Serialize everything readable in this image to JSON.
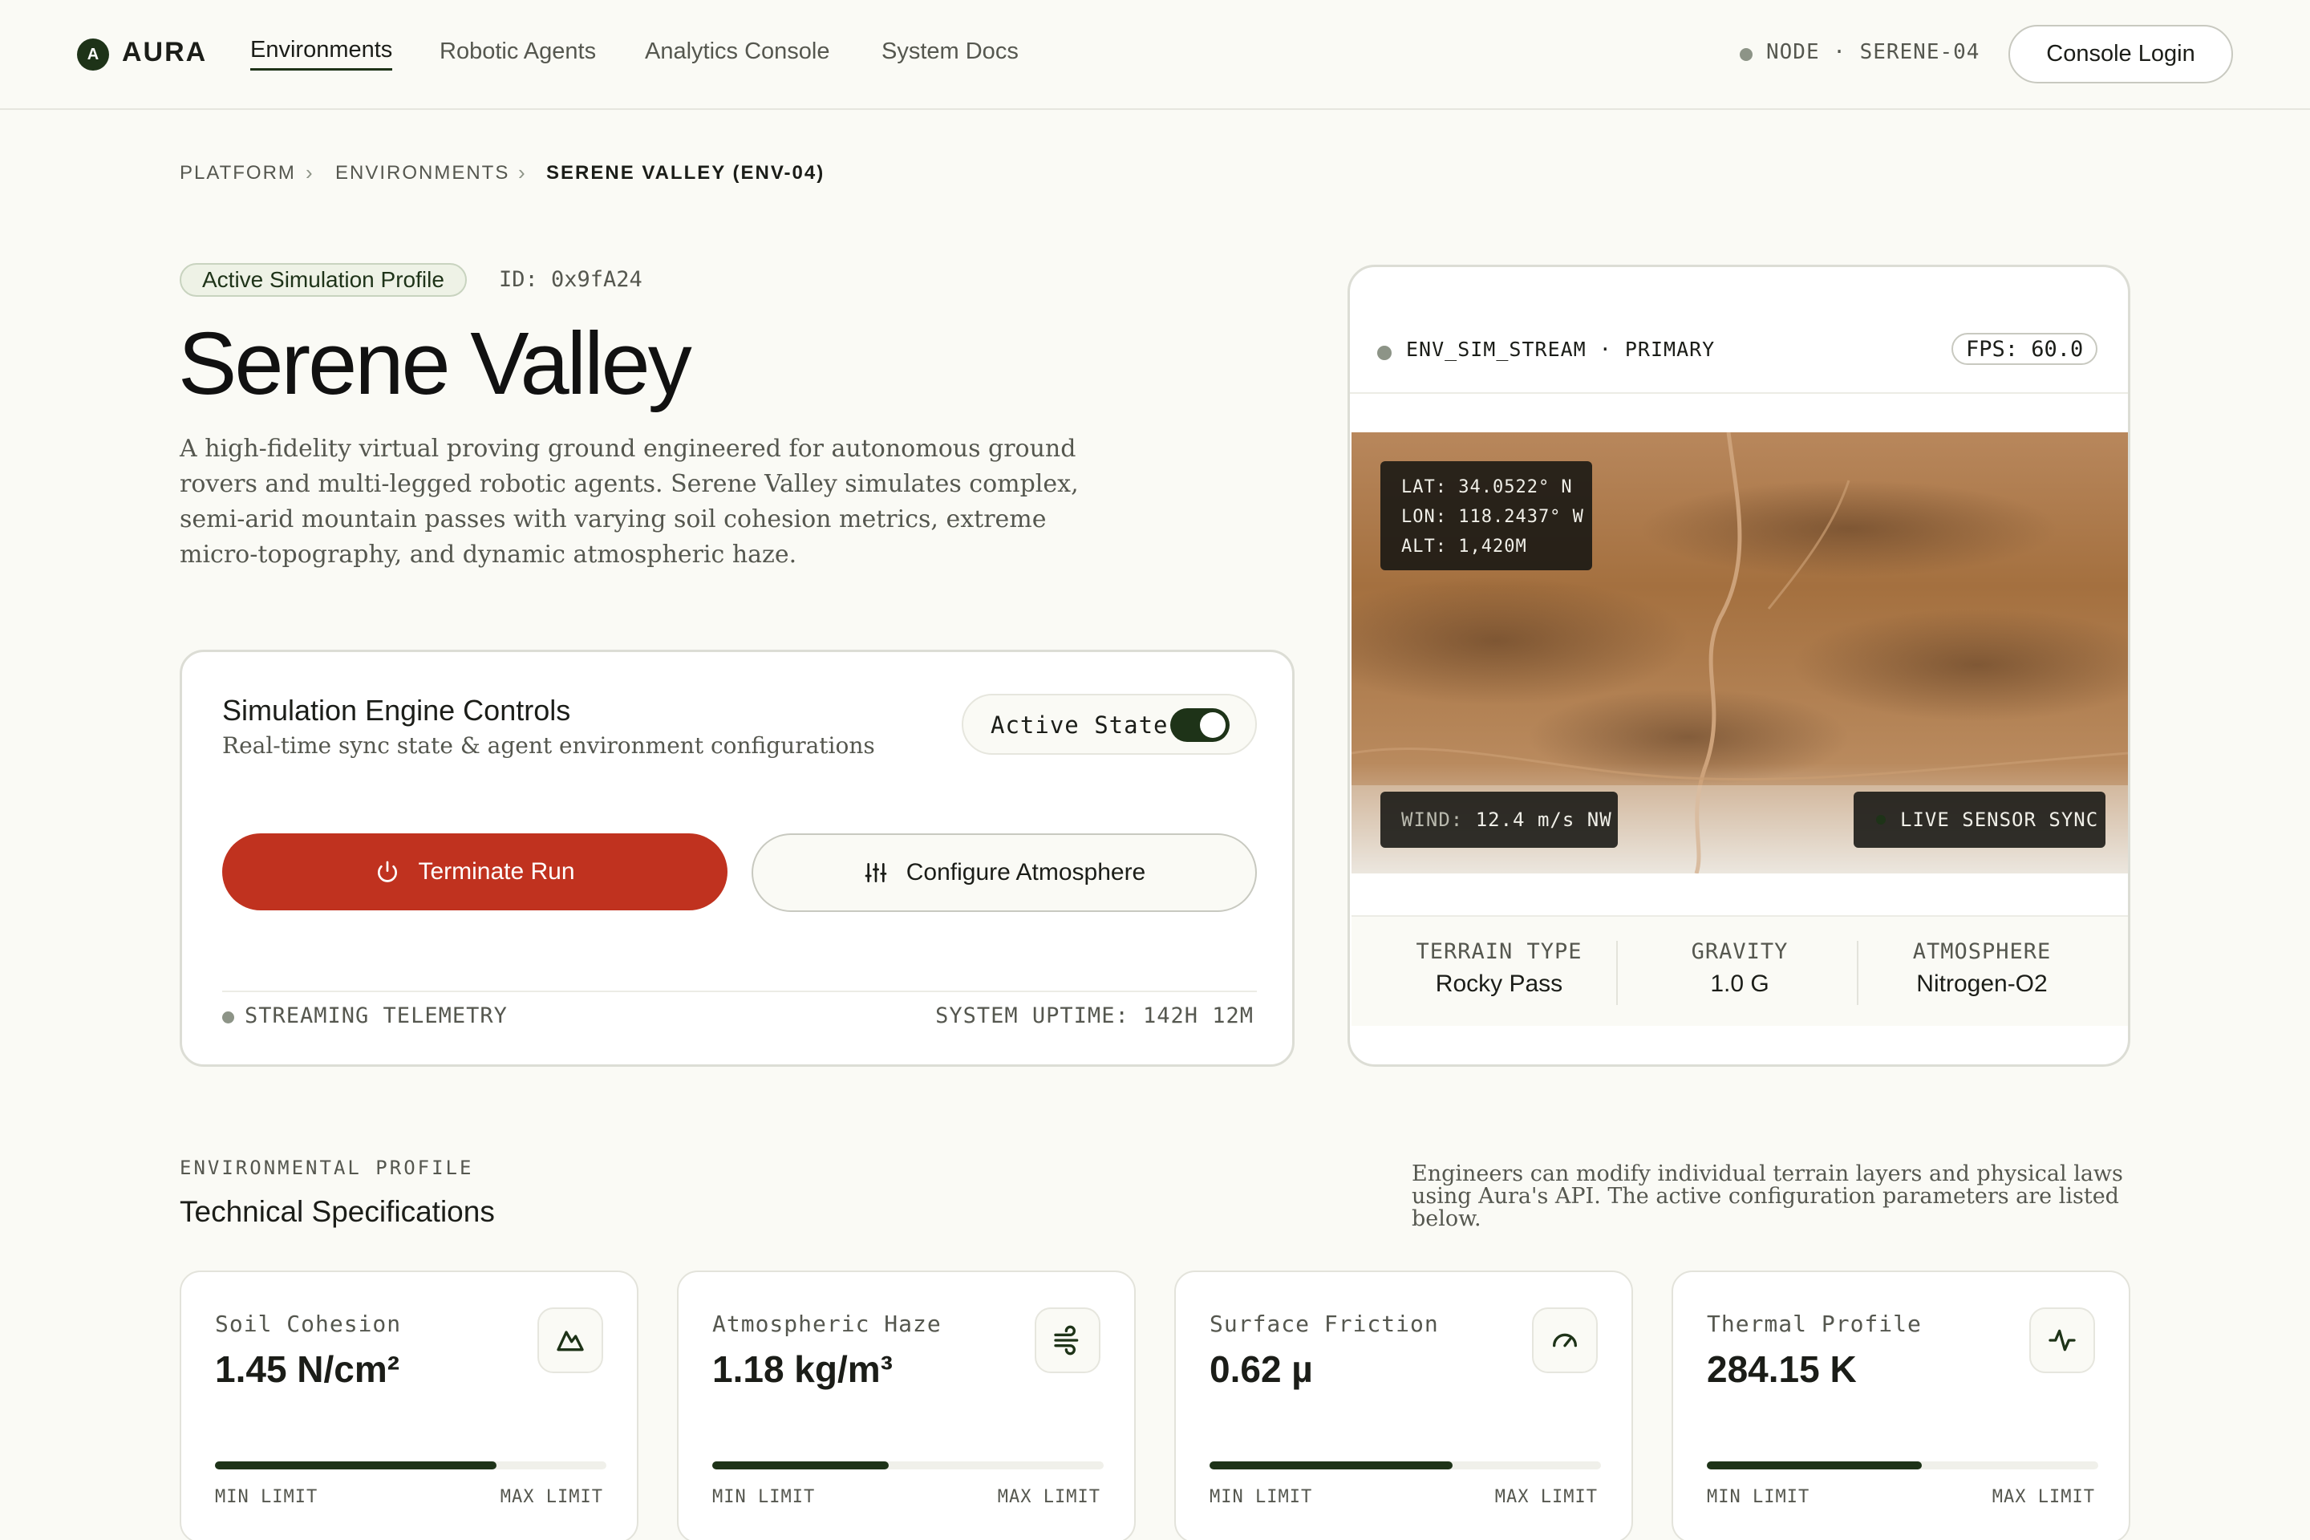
{
  "nav": {
    "logo_letter": "A",
    "logo_text": "AURA",
    "links": [
      "Environments",
      "Robotic Agents",
      "Analytics Console",
      "System Docs"
    ],
    "node_text": "NODE · SERENE-04",
    "login_label": "Console Login"
  },
  "breadcrumb": [
    "PLATFORM",
    "ENVIRONMENTS",
    "SERENE VALLEY (ENV-04)"
  ],
  "hero": {
    "badge": "Active Simulation Profile",
    "id": "ID: 0x9fA24",
    "title": "Serene Valley",
    "description": "A high-fidelity virtual proving ground engineered for autonomous ground rovers and multi-legged robotic agents. Serene Valley simulates complex, semi-arid mountain passes with varying soil cohesion metrics, extreme micro-topography, and dynamic atmospheric haze."
  },
  "controls": {
    "title": "Simulation Engine Controls",
    "subtitle": "Real-time sync state & agent environment configurations",
    "state_label": "Active State",
    "state_on": true,
    "terminate_label": "Terminate Run",
    "configure_label": "Configure Atmosphere",
    "telemetry": "STREAMING TELEMETRY",
    "uptime": "SYSTEM UPTIME: 142H 12M"
  },
  "stream": {
    "label": "ENV_SIM_STREAM · PRIMARY",
    "fps": "FPS: 60.0",
    "lat": "LAT: 34.0522° N",
    "lon": "LON: 118.2437° W",
    "alt": "ALT: 1,420M",
    "wind_key": "WIND:",
    "wind_value": "12.4 m/s NW",
    "live": "LIVE SENSOR SYNC",
    "stats": [
      {
        "label": "TERRAIN TYPE",
        "value": "Rocky Pass"
      },
      {
        "label": "GRAVITY",
        "value": "1.0 G"
      },
      {
        "label": "ATMOSPHERE",
        "value": "Nitrogen-O2"
      }
    ]
  },
  "specs": {
    "eyebrow": "ENVIRONMENTAL PROFILE",
    "title": "Technical Specifications",
    "note": "Engineers can modify individual terrain layers and physical laws using Aura's API. The active configuration parameters are listed below.",
    "min_label": "MIN LIMIT",
    "max_label": "MAX LIMIT",
    "cards": [
      {
        "label": "Soil Cohesion",
        "value": "1.45 N/cm²",
        "icon": "mountain-icon",
        "level": 0.72
      },
      {
        "label": "Atmospheric Haze",
        "value": "1.18 kg/m³",
        "icon": "wind-icon",
        "level": 0.45
      },
      {
        "label": "Surface Friction",
        "value": "0.62 µ",
        "icon": "gauge-icon",
        "level": 0.62
      },
      {
        "label": "Thermal Profile",
        "value": "284.15 K",
        "icon": "pulse-icon",
        "level": 0.55
      }
    ]
  },
  "colors": {
    "accent": "#1e3318",
    "danger": "#c0321f",
    "background": "#fafaf5"
  }
}
